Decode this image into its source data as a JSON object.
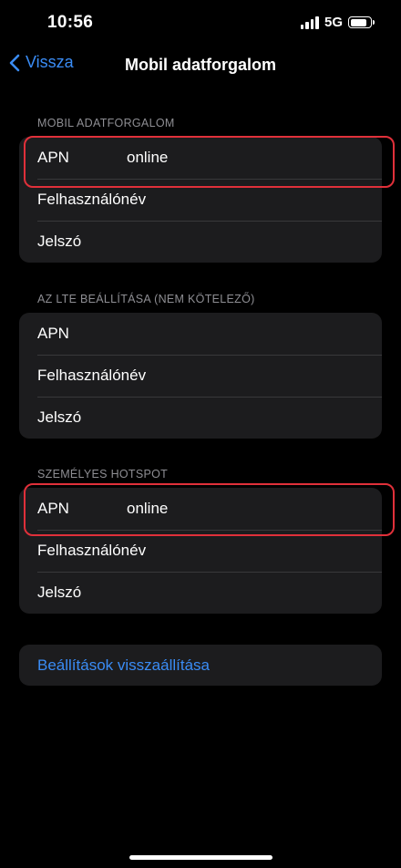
{
  "status_bar": {
    "time": "10:56",
    "network": "5G",
    "battery_level": 0.85
  },
  "nav": {
    "back_label": "Vissza",
    "title": "Mobil adatforgalom"
  },
  "sections": [
    {
      "header": "MOBIL ADATFORGALOM",
      "rows": [
        {
          "label": "APN",
          "value": "online"
        },
        {
          "label": "Felhasználónév",
          "value": ""
        },
        {
          "label": "Jelszó",
          "value": ""
        }
      ]
    },
    {
      "header": "AZ LTE BEÁLLÍTÁSA (NEM KÖTELEZŐ)",
      "rows": [
        {
          "label": "APN",
          "value": ""
        },
        {
          "label": "Felhasználónév",
          "value": ""
        },
        {
          "label": "Jelszó",
          "value": ""
        }
      ]
    },
    {
      "header": "SZEMÉLYES HOTSPOT",
      "rows": [
        {
          "label": "APN",
          "value": "online"
        },
        {
          "label": "Felhasználónév",
          "value": ""
        },
        {
          "label": "Jelszó",
          "value": ""
        }
      ]
    }
  ],
  "reset": {
    "label": "Beállítások visszaállítása"
  },
  "colors": {
    "accent": "#3a8cf5",
    "highlight": "#e0303a",
    "cell_background": "#1c1c1e"
  }
}
